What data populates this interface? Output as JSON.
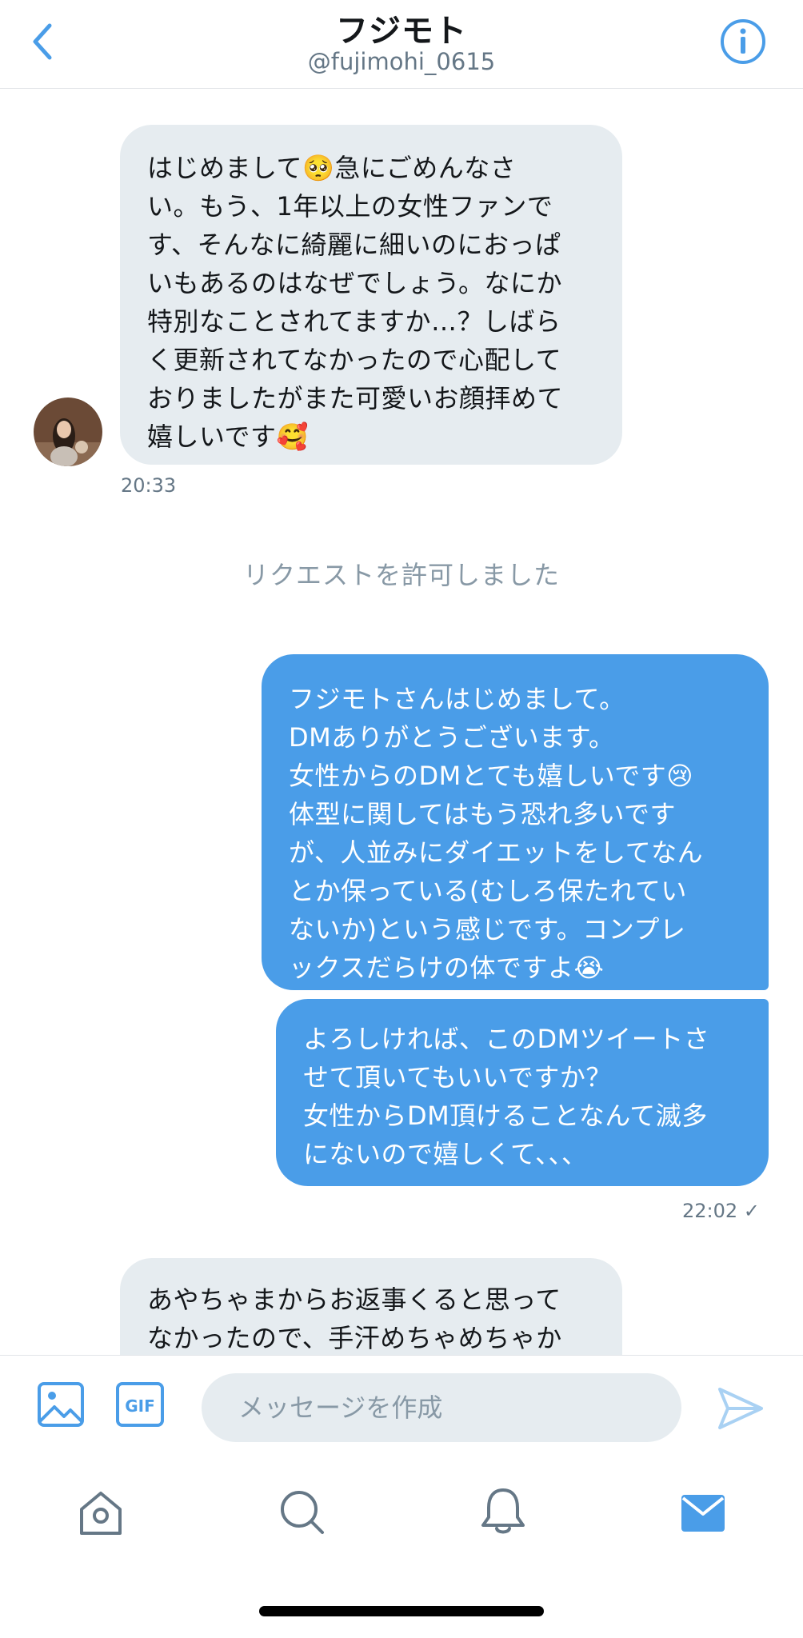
{
  "header": {
    "title": "フジモト",
    "handle": "@fujimohi_0615"
  },
  "messages": {
    "m1": {
      "text": "はじめまして🥺急にごめんなさ\nい。もう、1年以上の女性ファンで\nす、そんなに綺麗に細いのにおっぱ\nいもあるのはなぜでしょう。なにか\n特別なことされてますか…？しばら\nく更新されてなかったので心配して\nおりましたがまた可愛いお顔拝めて\n嬉しいです🥰",
      "time": "20:33"
    },
    "system": "リクエストを許可しました",
    "m2": {
      "text": "フジモトさんはじめまして。\nDMありがとうございます。\n女性からのDMとても嬉しいです😢\n体型に関してはもう恐れ多いです\nが、人並みにダイエットをしてなん\nとか保っている(むしろ保たれてい\nないか)という感じです。コンプレ\nックスだらけの体ですよ😭"
    },
    "m3": {
      "text": "よろしければ、このDMツイートさ\nせて頂いてもいいですか？\n女性からDM頂けることなんて滅多\nにないので嬉しくて、、、",
      "time": "22:02 ✓"
    },
    "m4": {
      "text": "あやちゃまからお返事くると思って\nなかったので、手汗めちゃめちゃか"
    }
  },
  "composer": {
    "placeholder": "メッセージを作成",
    "gif_label": "GIF"
  },
  "tabs": [
    "home",
    "search",
    "notifications",
    "messages"
  ],
  "colors": {
    "accent": "#4a9de8",
    "incoming_bubble": "#e6ecf0",
    "muted": "#657786"
  }
}
